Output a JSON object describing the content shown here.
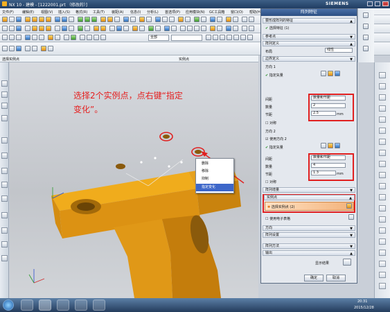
{
  "window": {
    "title": "NX 10 - 建模 - [1222001.prt （修改的）]",
    "brand": "SIEMENS"
  },
  "menu": [
    "文件(F)",
    "编辑(E)",
    "视图(V)",
    "插入(S)",
    "格式(R)",
    "工具(T)",
    "装配(A)",
    "信息(I)",
    "分析(L)",
    "首选项(P)",
    "应用模块(N)",
    "GC工具箱",
    "窗口(O)",
    "帮助(H)"
  ],
  "toolbar_select": {
    "filter": "全部",
    "scope": ""
  },
  "status": {
    "prompt": "选择实例点",
    "hint": "实例点"
  },
  "annotation": "选择2个实例点，点右键“指定变化”。",
  "context_menu": [
    "删除",
    "移除",
    "抑制",
    "指定变化"
  ],
  "dialog": {
    "title": "阵列特征",
    "section1": "要形成阵列的特征",
    "select_feature": "选择特征 (1)",
    "ref_point": "参考点",
    "array_def": "阵列定义",
    "layout_label": "布局",
    "layout_value": "线性",
    "boundary": "边界定义",
    "dir1": "方向 1",
    "specify_vector": "指定矢量",
    "spacing_label": "间距",
    "spacing_value": "数量和节距",
    "count_label": "数量",
    "count1": "2",
    "pitch_label": "节距",
    "pitch1": "2.5",
    "unit": "mm",
    "symmetric": "对称",
    "dir2": "方向 2",
    "use_dir2": "使用方向 2",
    "count2": "4",
    "pitch2": "1.3",
    "array_increment": "阵列增量",
    "instance_point": "实例点",
    "select_instance": "选择实例点 (2)",
    "use_spreadsheet": "使用电子表格",
    "direction": "方向",
    "array_settings": "阵列设置",
    "array_method": "阵列方法",
    "output": "输出",
    "show_result": "显示结果",
    "ok": "确定",
    "cancel": "取消"
  },
  "clock": {
    "time": "20:31",
    "date": "2015/12/28"
  }
}
